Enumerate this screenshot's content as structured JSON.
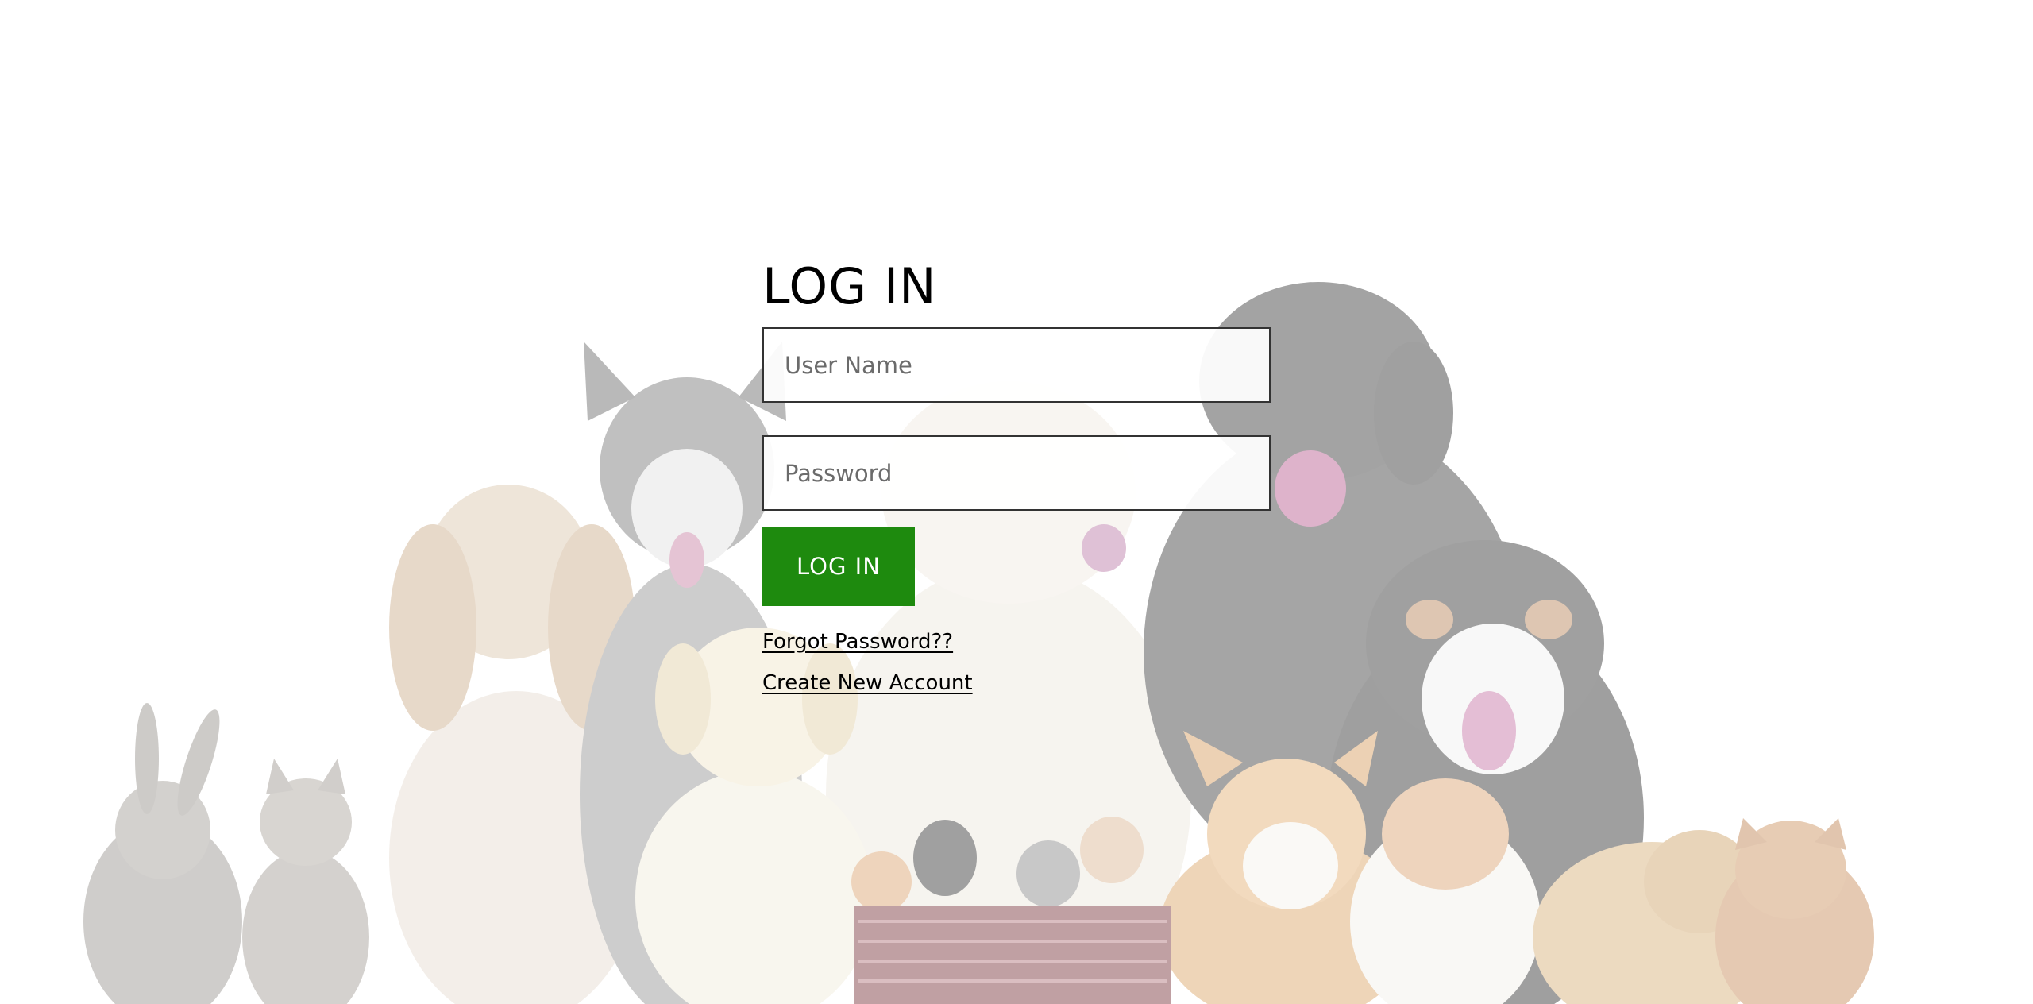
{
  "login": {
    "title": "LOG IN",
    "username_placeholder": "User Name",
    "password_placeholder": "Password",
    "button_label": "LOG IN",
    "forgot_password": "Forgot Password??",
    "create_account": "Create New Account"
  },
  "colors": {
    "button_bg": "#1e8a0e",
    "button_text": "#ffffff",
    "input_border": "#333333",
    "text": "#000000"
  },
  "background": {
    "subject": "pets"
  }
}
